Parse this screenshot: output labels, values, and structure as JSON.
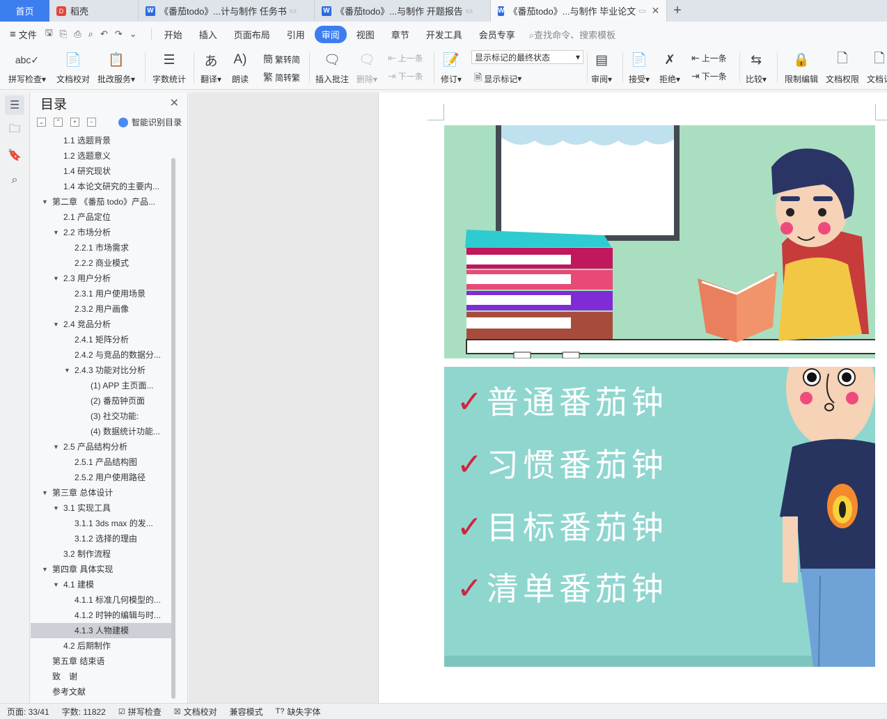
{
  "tabs": {
    "home": "首页",
    "docer": "稻壳",
    "doc1": "《番茄todo》...计与制作 任务书",
    "doc2": "《番茄todo》...与制作 开题报告",
    "doc3": "《番茄todo》...与制作 毕业论文"
  },
  "menu": {
    "file": "文件",
    "items": [
      "开始",
      "插入",
      "页面布局",
      "引用",
      "审阅",
      "视图",
      "章节",
      "开发工具",
      "会员专享"
    ],
    "active": "审阅",
    "search": "查找命令、搜索模板"
  },
  "ribbon": {
    "spell": "拼写检查",
    "proof": "文档校对",
    "batch": "批改服务",
    "wordcount": "字数统计",
    "translate": "翻译",
    "read": "朗读",
    "t2s": "繁转简",
    "s2t": "简转繁",
    "insert_comment": "插入批注",
    "delete": "删除",
    "prev_comment": "上一条",
    "next_comment": "下一条",
    "revise": "修订",
    "markup_state": "显示标记的最终状态",
    "show_markup": "显示标记",
    "review": "审阅",
    "accept": "接受",
    "reject": "拒绝",
    "prev_change": "上一条",
    "next_change": "下一条",
    "compare": "比较",
    "restrict": "限制编辑",
    "permission": "文档权限",
    "more": "文档认"
  },
  "toc": {
    "title": "目录",
    "smart": "智能识别目录",
    "items": [
      {
        "text": "1.1 选题背景",
        "level": 2,
        "caret": false
      },
      {
        "text": "1.2 选题意义",
        "level": 2,
        "caret": false
      },
      {
        "text": "1.4 研究现状",
        "level": 2,
        "caret": false
      },
      {
        "text": "1.4 本论文研究的主要内...",
        "level": 2,
        "caret": false
      },
      {
        "text": "第二章 《番茄 todo》产品...",
        "level": 1,
        "caret": true
      },
      {
        "text": "2.1 产品定位",
        "level": 2,
        "caret": false
      },
      {
        "text": "2.2 市场分析",
        "level": 2,
        "caret": true
      },
      {
        "text": "2.2.1 市场需求",
        "level": 3,
        "caret": false
      },
      {
        "text": "2.2.2 商业模式",
        "level": 3,
        "caret": false
      },
      {
        "text": "2.3 用户分析",
        "level": 2,
        "caret": true
      },
      {
        "text": "2.3.1 用户使用场景",
        "level": 3,
        "caret": false
      },
      {
        "text": "2.3.2 用户画像",
        "level": 3,
        "caret": false
      },
      {
        "text": "2.4 竞品分析",
        "level": 2,
        "caret": true
      },
      {
        "text": "2.4.1 矩阵分析",
        "level": 3,
        "caret": false
      },
      {
        "text": "2.4.2 与竞品的数据分...",
        "level": 3,
        "caret": false
      },
      {
        "text": "2.4.3 功能对比分析",
        "level": 3,
        "caret": true
      },
      {
        "text": "(1) APP 主页面...",
        "level": 4,
        "caret": false
      },
      {
        "text": "(2) 番茄钟页面",
        "level": 4,
        "caret": false
      },
      {
        "text": "(3) 社交功能:",
        "level": 4,
        "caret": false
      },
      {
        "text": "(4) 数据统计功能...",
        "level": 4,
        "caret": false
      },
      {
        "text": "2.5 产品结构分析",
        "level": 2,
        "caret": true
      },
      {
        "text": "2.5.1 产品结构图",
        "level": 3,
        "caret": false
      },
      {
        "text": "2.5.2 用户使用路径",
        "level": 3,
        "caret": false
      },
      {
        "text": "第三章 总体设计",
        "level": 1,
        "caret": true
      },
      {
        "text": "3.1 实现工具",
        "level": 2,
        "caret": true
      },
      {
        "text": "3.1.1 3ds max 的发...",
        "level": 3,
        "caret": false
      },
      {
        "text": "3.1.2 选择的理由",
        "level": 3,
        "caret": false
      },
      {
        "text": "3.2 制作流程",
        "level": 2,
        "caret": false
      },
      {
        "text": "第四章 具体实现",
        "level": 1,
        "caret": true
      },
      {
        "text": "4.1 建模",
        "level": 2,
        "caret": true
      },
      {
        "text": "4.1.1 标准几何模型的...",
        "level": 3,
        "caret": false
      },
      {
        "text": "4.1.2 时钟的编辑与时...",
        "level": 3,
        "caret": false
      },
      {
        "text": "4.1.3 人物建模",
        "level": 3,
        "caret": false,
        "selected": true
      },
      {
        "text": "4.2 后期制作",
        "level": 2,
        "caret": false
      },
      {
        "text": "第五章 结束语",
        "level": 1,
        "caret": false
      },
      {
        "text": "致　谢",
        "level": 1,
        "caret": false
      },
      {
        "text": "参考文献",
        "level": 1,
        "caret": false
      }
    ]
  },
  "document": {
    "checklist": [
      "普通番茄钟",
      "习惯番茄钟",
      "目标番茄钟",
      "清单番茄钟"
    ]
  },
  "status": {
    "page": "页面: 33/41",
    "words": "字数: 11822",
    "spell": "拼写检查",
    "proof": "文档校对",
    "compat": "兼容模式",
    "missing_font": "缺失字体"
  },
  "colors": {
    "accent": "#3c7ef0",
    "check": "#d0243c"
  }
}
